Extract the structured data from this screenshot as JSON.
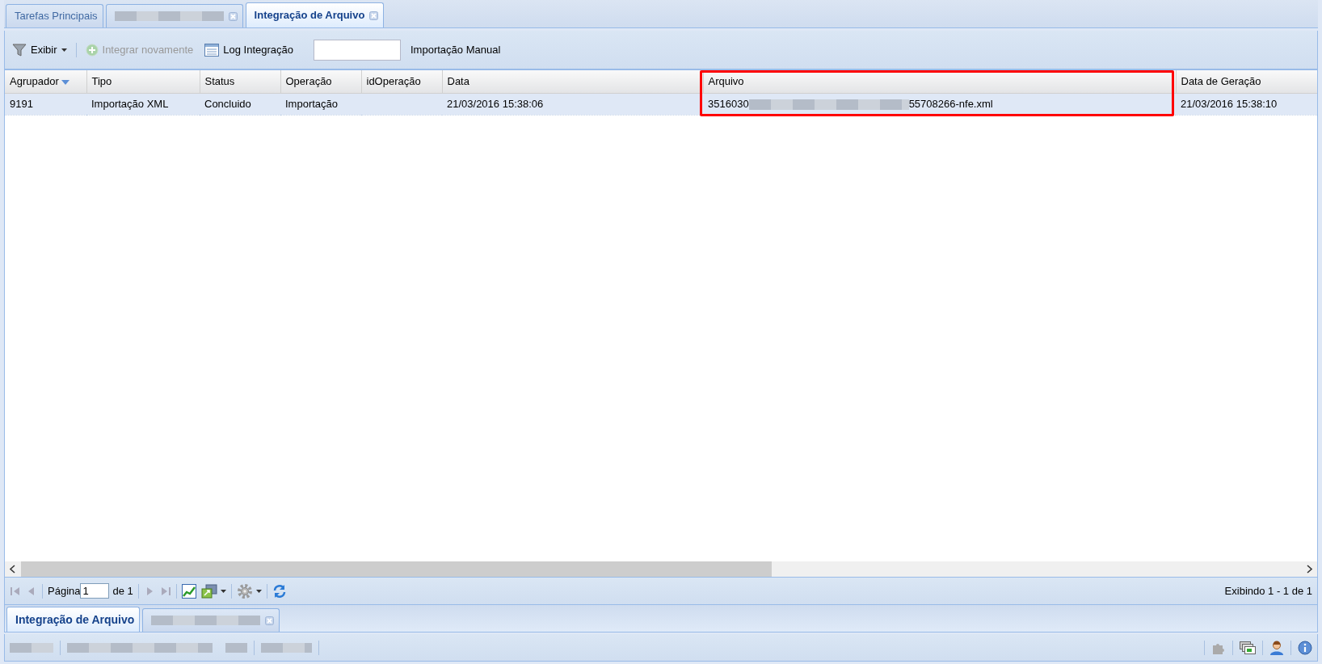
{
  "top_tabs": [
    {
      "label": "Tarefas Principais",
      "selected": false,
      "closable": false
    },
    {
      "redacted": true,
      "selected": false,
      "closable": true
    },
    {
      "label": "Integração de Arquivo",
      "selected": true,
      "closable": true
    }
  ],
  "toolbar": {
    "view_menu": "Exibir",
    "reintegrate": {
      "label": "Integrar novamente",
      "disabled": true
    },
    "log": {
      "label": "Log Integração",
      "disabled": false
    },
    "manual_import": "Importação Manual"
  },
  "grid": {
    "columns": [
      {
        "label": "Agrupador",
        "sorted": true,
        "highlighted": false
      },
      {
        "label": "Tipo",
        "sorted": false,
        "highlighted": false
      },
      {
        "label": "Status",
        "sorted": false,
        "highlighted": false
      },
      {
        "label": "Operação",
        "sorted": false,
        "highlighted": false
      },
      {
        "label": "idOperação",
        "sorted": false,
        "highlighted": false
      },
      {
        "label": "Data",
        "sorted": false,
        "highlighted": false
      },
      {
        "label": "Arquivo",
        "sorted": false,
        "highlighted": true
      },
      {
        "label": "Data de Geração",
        "sorted": false,
        "highlighted": false
      }
    ],
    "rows": [
      {
        "selected": true,
        "agrupador": "9191",
        "tipo": "Importação XML",
        "status": "Concluido",
        "operacao": "Importação",
        "data": "21/03/2016 15:38:06",
        "arquivo_prefix": "3516030",
        "arquivo_suffix": "55708266-nfe.xml",
        "data_geracao": "21/03/2016 15:38:10"
      }
    ]
  },
  "pager": {
    "page_label": "Página",
    "page": "1",
    "of_label": "de 1",
    "summary": "Exibindo 1 - 1 de 1"
  },
  "bottom_tabs": [
    {
      "label": "Integração de Arquivo",
      "selected": true,
      "closable": false
    },
    {
      "redacted": true,
      "selected": false,
      "closable": true
    }
  ]
}
